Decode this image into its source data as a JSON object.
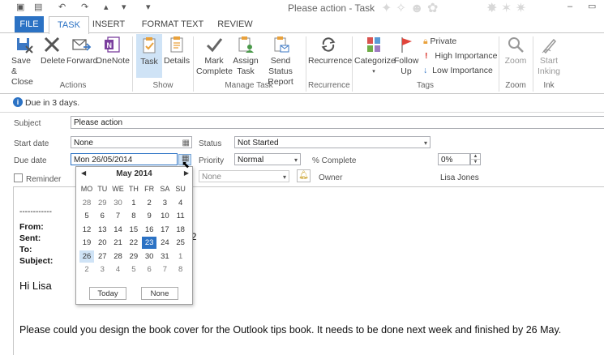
{
  "window": {
    "title": "Please action - Task"
  },
  "tabs": [
    {
      "label": "FILE"
    },
    {
      "label": "TASK"
    },
    {
      "label": "INSERT"
    },
    {
      "label": "FORMAT TEXT"
    },
    {
      "label": "REVIEW"
    }
  ],
  "ribbon": {
    "actions": {
      "save_close": "Save &\nClose",
      "delete": "Delete",
      "forward": "Forward",
      "onenote": "OneNote",
      "group": "Actions"
    },
    "show": {
      "task": "Task",
      "details": "Details",
      "group": "Show"
    },
    "manage": {
      "mark_complete": "Mark\nComplete",
      "assign_task": "Assign\nTask",
      "send_status": "Send Status\nReport",
      "group": "Manage Task"
    },
    "recurrence": {
      "recurrence": "Recurrence",
      "group": "Recurrence"
    },
    "tags": {
      "categorize": "Categorize",
      "follow_up": "Follow\nUp",
      "private": "Private",
      "high_importance": "High Importance",
      "low_importance": "Low Importance",
      "group": "Tags"
    },
    "zoom": {
      "zoom": "Zoom",
      "group": "Zoom"
    },
    "ink": {
      "start_inking": "Start\nInking",
      "group": "Ink"
    }
  },
  "info": {
    "text": "Due in 3 days."
  },
  "form": {
    "subject_label": "Subject",
    "subject_value": "Please action",
    "start_label": "Start date",
    "start_value": "None",
    "due_label": "Due date",
    "due_value": "Mon 26/05/2014",
    "status_label": "Status",
    "status_value": "Not Started",
    "priority_label": "Priority",
    "priority_value": "Normal",
    "complete_label": "% Complete",
    "complete_value": "0%",
    "reminder_label": "Reminder",
    "reminder_time": "None",
    "owner_label": "Owner",
    "owner_value": "Lisa Jones"
  },
  "calendar": {
    "month": "May 2014",
    "weekdays": [
      "MO",
      "TU",
      "WE",
      "TH",
      "FR",
      "SA",
      "SU"
    ],
    "weeks": [
      [
        "28",
        "29",
        "30",
        "1",
        "2",
        "3",
        "4"
      ],
      [
        "5",
        "6",
        "7",
        "8",
        "9",
        "10",
        "11"
      ],
      [
        "12",
        "13",
        "14",
        "15",
        "16",
        "17",
        "18"
      ],
      [
        "19",
        "20",
        "21",
        "22",
        "23",
        "24",
        "25"
      ],
      [
        "26",
        "27",
        "28",
        "29",
        "30",
        "31",
        "1"
      ],
      [
        "2",
        "3",
        "4",
        "5",
        "6",
        "7",
        "8"
      ]
    ],
    "today": "23",
    "selected": "26",
    "today_button": "Today",
    "none_button": "None"
  },
  "body": {
    "separator": "------------",
    "from": "From:",
    "sent": "Sent:",
    "to": "To:",
    "subject": "Subject:",
    "partial": "2",
    "greeting": "Hi Lisa",
    "message": "Please could you design the book cover for the Outlook tips book. It needs to be done next week and finished by 26 May."
  },
  "colors": {
    "accent": "#2b72c4",
    "selected": "#cfe3f6"
  }
}
